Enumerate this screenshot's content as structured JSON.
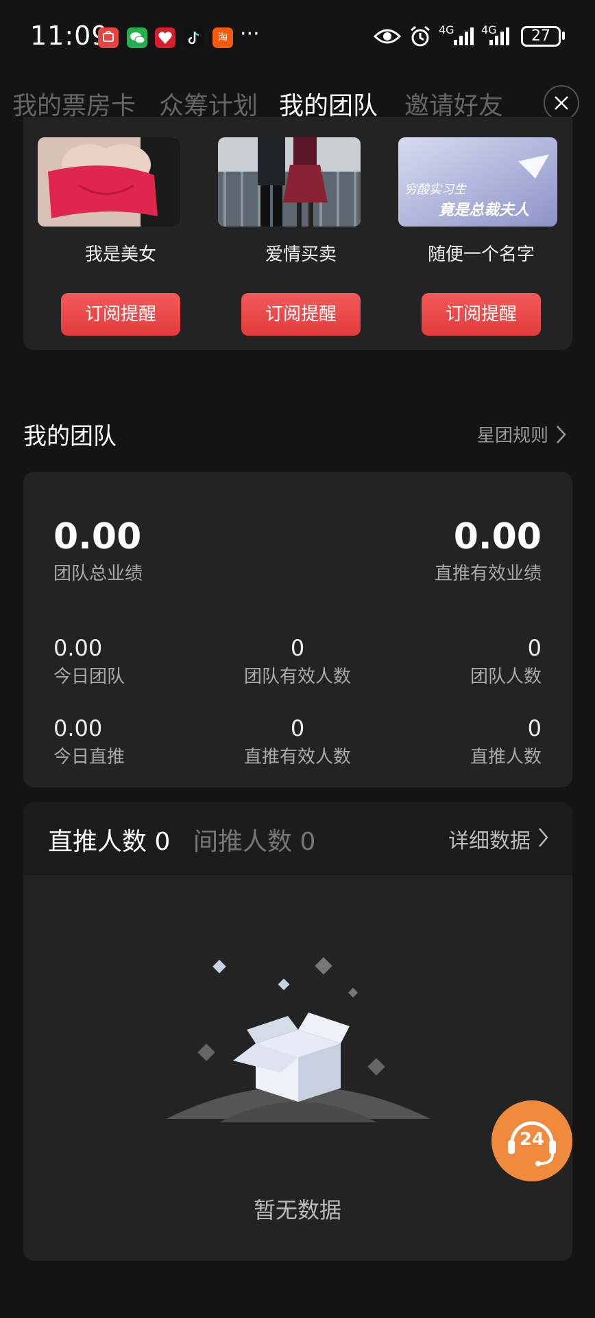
{
  "status": {
    "time": "11:09",
    "dots": "···",
    "net1": "4G",
    "net2": "4G",
    "battery": "27",
    "apps": [
      "huawei-icon",
      "wechat-icon",
      "heart-app-icon",
      "tiktok-icon",
      "taobao-icon"
    ],
    "taobao_label": "淘"
  },
  "tabs": [
    "我的票房卡",
    "众筹计划",
    "我的团队",
    "邀请好友"
  ],
  "active_tab": 2,
  "movies": [
    {
      "name": "我是美女",
      "button": "订阅提醒"
    },
    {
      "name": "爱情买卖",
      "button": "订阅提醒"
    },
    {
      "name": "随便一个名字",
      "button": "订阅提醒"
    }
  ],
  "poster3_text": [
    "穷酸实习生",
    "竟是总裁夫人"
  ],
  "team": {
    "title": "我的团队",
    "rules_link": "星团规则",
    "total": {
      "value": "0.00",
      "label": "团队总业绩"
    },
    "direct_valid": {
      "value": "0.00",
      "label": "直推有效业绩"
    },
    "row1": [
      {
        "value": "0.00",
        "label": "今日团队"
      },
      {
        "value": "0",
        "label": "团队有效人数"
      },
      {
        "value": "0",
        "label": "团队人数"
      }
    ],
    "row2": [
      {
        "value": "0.00",
        "label": "今日直推"
      },
      {
        "value": "0",
        "label": "直推有效人数"
      },
      {
        "value": "0",
        "label": "直推人数"
      }
    ]
  },
  "referrals": {
    "direct": "直推人数 0",
    "indirect": "间推人数 0",
    "detail_link": "详细数据",
    "empty_text": "暂无数据"
  },
  "support_badge": "24",
  "colors": {
    "accent_red": "#e84545",
    "support_orange": "#f08a3c",
    "background": "#141414",
    "card": "#232323"
  }
}
